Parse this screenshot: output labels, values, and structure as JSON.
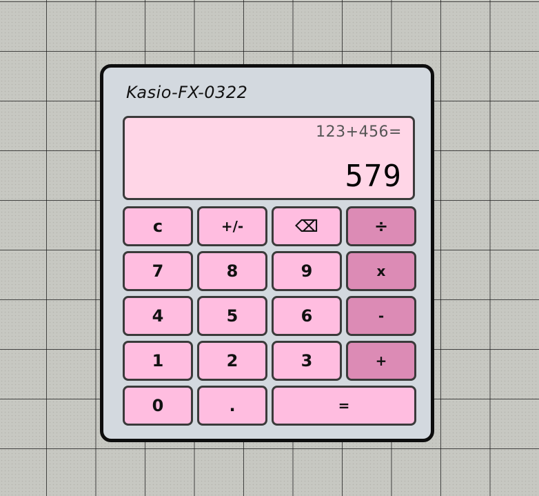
{
  "calculator": {
    "brand": "Kasio-FX-0322",
    "display": {
      "expression": "123+456=",
      "result": "579"
    },
    "keys": {
      "clear": "c",
      "negate": "+/-",
      "backspace": "⌫",
      "divide": "÷",
      "seven": "7",
      "eight": "8",
      "nine": "9",
      "multiply": "x",
      "four": "4",
      "five": "5",
      "six": "6",
      "subtract": "-",
      "one": "1",
      "two": "2",
      "three": "3",
      "add": "+",
      "zero": "0",
      "decimal": ".",
      "equals": "="
    }
  },
  "colors": {
    "body": "#d3d9df",
    "display": "#ffd6e7",
    "key": "#ffbde0",
    "operator_key": "#dc8bb5",
    "border": "#3a3a3a"
  }
}
